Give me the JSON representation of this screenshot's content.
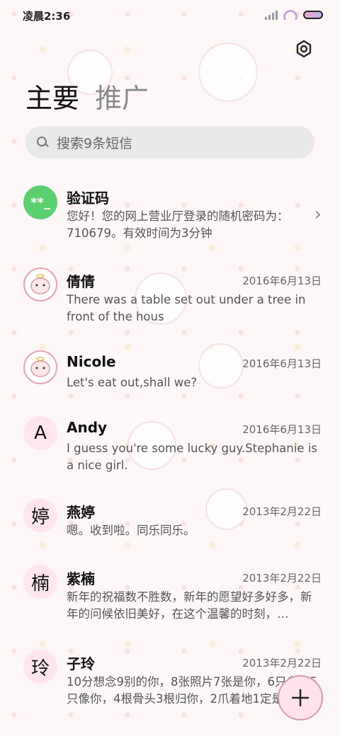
{
  "status": {
    "time": "凌晨2:36"
  },
  "header": {
    "tab_main": "主要",
    "tab_promo": "推广"
  },
  "search": {
    "placeholder": "搜索9条短信"
  },
  "messages": [
    {
      "name": "验证码",
      "avatar_text": "**_",
      "date": "",
      "preview": "您好！您的网上营业厅登录的随机密码为：710679。有效时间为3分钟"
    },
    {
      "name": "倩倩",
      "avatar_text": "",
      "date": "2016年6月13日",
      "preview": "There was a table set out under a tree in front of the hous"
    },
    {
      "name": "Nicole",
      "avatar_text": "",
      "date": "2016年6月13日",
      "preview": "Let's eat out,shall we?"
    },
    {
      "name": "Andy",
      "avatar_text": "A",
      "date": "2016年6月13日",
      "preview": "I guess you're some lucky guy.Stephanie is a nice girl."
    },
    {
      "name": "燕婷",
      "avatar_text": "婷",
      "date": "2013年2月22日",
      "preview": "嗯。收到啦。同乐同乐。"
    },
    {
      "name": "紫楠",
      "avatar_text": "楠",
      "date": "2013年2月22日",
      "preview": "新年的祝福数不胜数，新年的愿望好多好多，新年的问候依旧美好，在这个温馨的时刻，…"
    },
    {
      "name": "子玲",
      "avatar_text": "玲",
      "date": "2013年2月22日",
      "preview": "10分想念9别的你，8张照片7张是你，6只乌龟5只像你，4根骨头3根归你，2爪着地1定是你"
    }
  ],
  "colors": {
    "accent": "#5bd06f",
    "fab_bg": "#ffe2ec",
    "avatar_letter_bg": "#ffe6ee"
  },
  "icons": {
    "settings": "gear-icon",
    "search": "search-icon",
    "compose": "plus-icon",
    "chevron": "chevron-right-icon"
  }
}
